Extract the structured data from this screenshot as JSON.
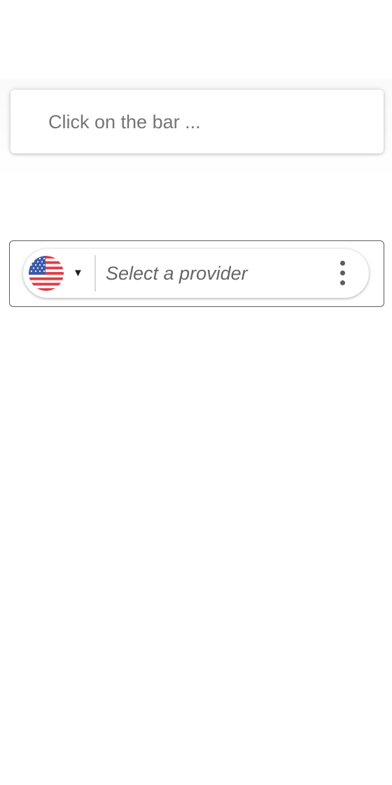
{
  "search_bar": {
    "placeholder": "Click on the bar ..."
  },
  "provider_bar": {
    "country": {
      "flag_icon": "us-flag-icon",
      "dropdown_icon": "caret-down-icon",
      "caret_glyph": "▼"
    },
    "provider_input": {
      "value": "",
      "placeholder": "Select a provider"
    },
    "menu_icon": "more-vertical-icon"
  },
  "colors": {
    "placeholder_text": "#757575",
    "card_border": "#5f5f5f",
    "flag_red": "#e43a45",
    "flag_blue": "#3b5aa8",
    "icon_gray": "#5c5c5c"
  }
}
